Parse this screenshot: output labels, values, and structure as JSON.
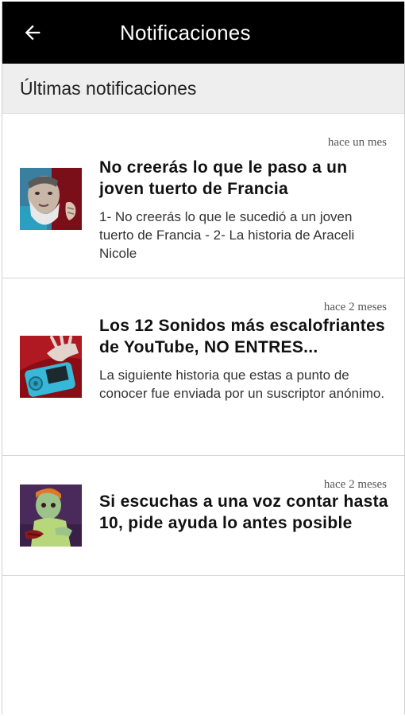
{
  "appbar": {
    "title": "Notificaciones",
    "back_icon": "arrow-left-icon",
    "background": "#000000"
  },
  "section": {
    "title": "Últimas notificaciones"
  },
  "notifications": [
    {
      "time": "hace un mes",
      "title": "No creerás lo que le paso a un joven tuerto de Francia",
      "description": "1- No creerás lo que le sucedió a un joven tuerto de Francia - 2- La historia de Araceli Nicole",
      "thumbnail_icon": "bearded-man-thumbnail"
    },
    {
      "time": "hace 2 meses",
      "title": "Los 12 Sonidos más escalofriantes de YouTube, NO ENTRES...",
      "description": "La siguiente historia que estas a punto de conocer fue enviada por un suscriptor anónimo.",
      "thumbnail_icon": "hand-and-device-thumbnail"
    },
    {
      "time": "hace 2 meses",
      "title": "Si escuchas a una voz contar hasta 10, pide ayuda lo antes posible",
      "description": "",
      "thumbnail_icon": "zombie-child-thumbnail"
    }
  ]
}
